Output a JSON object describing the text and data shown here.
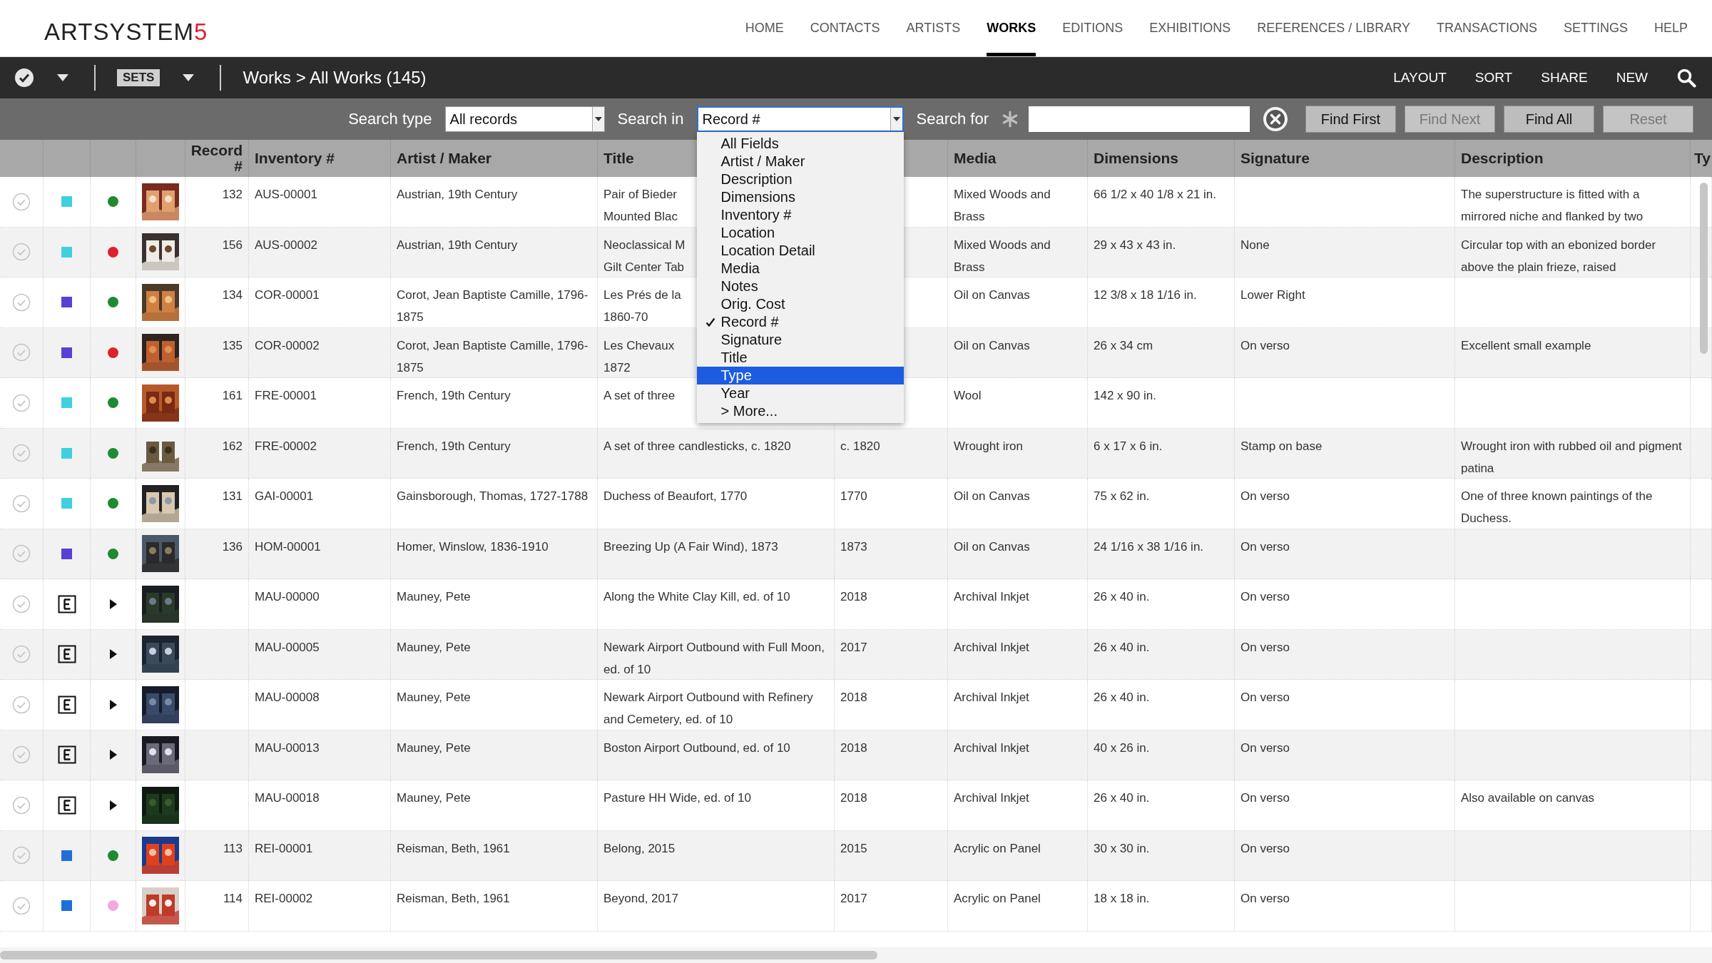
{
  "logo": {
    "text": "ARTSYSTEM",
    "accent": "5"
  },
  "nav": [
    {
      "label": "HOME",
      "selected": false
    },
    {
      "label": "CONTACTS",
      "selected": false
    },
    {
      "label": "ARTISTS",
      "selected": false
    },
    {
      "label": "WORKS",
      "selected": true
    },
    {
      "label": "EDITIONS",
      "selected": false
    },
    {
      "label": "EXHIBITIONS",
      "selected": false
    },
    {
      "label": "REFERENCES / LIBRARY",
      "selected": false
    },
    {
      "label": "TRANSACTIONS",
      "selected": false
    },
    {
      "label": "SETTINGS",
      "selected": false
    },
    {
      "label": "HELP",
      "selected": false
    }
  ],
  "toolbar": {
    "sets": "SETS",
    "breadcrumb": "Works > All Works (145)",
    "actions": [
      "LAYOUT",
      "SORT",
      "SHARE",
      "NEW"
    ]
  },
  "search": {
    "type_label": "Search type",
    "type_value": "All records",
    "in_label": "Search in",
    "in_value": "Record #",
    "for_label": "Search for",
    "menu": [
      {
        "label": "All Fields",
        "checked": false,
        "highlighted": false
      },
      {
        "label": "Artist / Maker",
        "checked": false,
        "highlighted": false
      },
      {
        "label": "Description",
        "checked": false,
        "highlighted": false
      },
      {
        "label": "Dimensions",
        "checked": false,
        "highlighted": false
      },
      {
        "label": "Inventory #",
        "checked": false,
        "highlighted": false
      },
      {
        "label": "Location",
        "checked": false,
        "highlighted": false
      },
      {
        "label": "Location Detail",
        "checked": false,
        "highlighted": false
      },
      {
        "label": "Media",
        "checked": false,
        "highlighted": false
      },
      {
        "label": "Notes",
        "checked": false,
        "highlighted": false
      },
      {
        "label": "Orig. Cost",
        "checked": false,
        "highlighted": false
      },
      {
        "label": "Record #",
        "checked": true,
        "highlighted": false
      },
      {
        "label": "Signature",
        "checked": false,
        "highlighted": false
      },
      {
        "label": "Title",
        "checked": false,
        "highlighted": false
      },
      {
        "label": "Type",
        "checked": false,
        "highlighted": true
      },
      {
        "label": "Year",
        "checked": false,
        "highlighted": false
      },
      {
        "label": "> More...",
        "checked": false,
        "highlighted": false
      }
    ],
    "buttons": [
      {
        "label": "Find First",
        "disabled": false
      },
      {
        "label": "Find Next",
        "disabled": true
      },
      {
        "label": "Find All",
        "disabled": false
      },
      {
        "label": "Reset",
        "disabled": true
      }
    ]
  },
  "table": {
    "columns": [
      "Record #",
      "Inventory #",
      "Artist / Maker",
      "Title",
      null,
      "Media",
      "Dimensions",
      "Signature",
      "Description",
      "Ty"
    ],
    "rows": [
      {
        "kind": "record",
        "selected": false,
        "color": "#3fd0df",
        "status": {
          "color": "#1e8a32"
        },
        "cells": [
          "132",
          "AUS-00001",
          "Austrian, 19th Century",
          "Pair of Bieder\nMounted Blac",
          null,
          "Mixed Woods and Brass",
          "66 1/2 x 40 1/8 x 21 in.",
          null,
          "The superstructure is fitted with a mirrored niche and flanked by two"
        ]
      },
      {
        "kind": "record",
        "selected": false,
        "color": "#3fd0df",
        "status": {
          "color": "#e0202a"
        },
        "cells": [
          "156",
          "AUS-00002",
          "Austrian, 19th Century",
          "Neoclassical M\nGilt Center Tab",
          null,
          "Mixed Woods and Brass",
          "29 x 43 x 43 in.",
          "None",
          "Circular top with an ebonized border above the plain frieze, raised"
        ]
      },
      {
        "kind": "record",
        "selected": false,
        "color": "#5a3fd6",
        "status": {
          "color": "#1e8a32"
        },
        "cells": [
          "134",
          "COR-00001",
          "Corot, Jean Baptiste Camille, 1796-1875",
          "Les Prés de la\n1860-70",
          null,
          "Oil on Canvas",
          "12 3/8 x 18 1/16 in.",
          "Lower Right",
          null
        ]
      },
      {
        "kind": "record",
        "selected": false,
        "color": "#5a3fd6",
        "status": {
          "color": "#e0202a"
        },
        "cells": [
          "135",
          "COR-00002",
          "Corot, Jean Baptiste Camille, 1796-1875",
          "Les Chevaux\n1872",
          null,
          "Oil on Canvas",
          "26 x 34 cm",
          "On verso",
          "Excellent small example"
        ]
      },
      {
        "kind": "record",
        "selected": false,
        "color": "#3fd0df",
        "status": {
          "color": "#1e8a32"
        },
        "cells": [
          "161",
          "FRE-00001",
          "French, 19th Century",
          "A set of three",
          null,
          "Wool",
          "142 x 90 in.",
          null,
          null
        ]
      },
      {
        "kind": "record",
        "selected": false,
        "color": "#3fd0df",
        "status": {
          "color": "#1e8a32"
        },
        "cells": [
          "162",
          "FRE-00002",
          "French, 19th Century",
          "A set of three candlesticks, c. 1820",
          "c. 1820",
          "Wrought iron",
          "6 x 17 x 6 in.",
          "Stamp on base",
          "Wrought iron with rubbed oil and pigment patina"
        ]
      },
      {
        "kind": "record",
        "selected": false,
        "color": "#3fd0df",
        "status": {
          "color": "#1e8a32"
        },
        "cells": [
          "131",
          "GAI-00001",
          "Gainsborough, Thomas, 1727-1788",
          "Duchess of Beaufort, 1770",
          "1770",
          "Oil on Canvas",
          "75 x 62 in.",
          "On verso",
          "One of three known paintings of the Duchess."
        ]
      },
      {
        "kind": "record",
        "selected": false,
        "color": "#5a3fd6",
        "status": {
          "color": "#1e8a32"
        },
        "cells": [
          "136",
          "HOM-00001",
          "Homer, Winslow, 1836-1910",
          "Breezing Up (A Fair Wind), 1873",
          "1873",
          "Oil on Canvas",
          "24 1/16 x 38 1/16 in.",
          "On verso",
          null
        ]
      },
      {
        "kind": "edition",
        "selected": false,
        "expanded": false,
        "cells": [
          null,
          "MAU-00000",
          "Mauney, Pete",
          "Along the White Clay Kill, ed. of 10",
          "2018",
          "Archival Inkjet",
          "26 x 40 in.",
          "On verso",
          null
        ]
      },
      {
        "kind": "edition",
        "selected": false,
        "expanded": false,
        "cells": [
          null,
          "MAU-00005",
          "Mauney, Pete",
          "Newark Airport Outbound with Full Moon, ed. of 10",
          "2017",
          "Archival Inkjet",
          "26 x 40 in.",
          "On verso",
          null
        ]
      },
      {
        "kind": "edition",
        "selected": false,
        "expanded": false,
        "cells": [
          null,
          "MAU-00008",
          "Mauney, Pete",
          "Newark Airport Outbound with Refinery and Cemetery, ed. of 10",
          "2018",
          "Archival Inkjet",
          "26 x 40 in.",
          "On verso",
          null
        ]
      },
      {
        "kind": "edition",
        "selected": false,
        "expanded": false,
        "cells": [
          null,
          "MAU-00013",
          "Mauney, Pete",
          "Boston Airport Outbound, ed. of 10",
          "2018",
          "Archival Inkjet",
          "40 x 26 in.",
          "On verso",
          null
        ]
      },
      {
        "kind": "edition",
        "selected": false,
        "expanded": false,
        "cells": [
          null,
          "MAU-00018",
          "Mauney, Pete",
          "Pasture HH Wide, ed. of 10",
          "2018",
          "Archival Inkjet",
          "26 x 40 in.",
          "On verso",
          "Also available on canvas"
        ]
      },
      {
        "kind": "record",
        "selected": false,
        "color": "#1f6fd8",
        "status": {
          "color": "#1e8a32"
        },
        "cells": [
          "113",
          "REI-00001",
          "Reisman, Beth, 1961",
          "Belong, 2015",
          "2015",
          "Acrylic on Panel",
          "30 x 30 in.",
          "On verso",
          null
        ]
      },
      {
        "kind": "record",
        "selected": false,
        "color": "#1f6fd8",
        "status": {
          "color": "#f4a8dc"
        },
        "cells": [
          "114",
          "REI-00002",
          "Reisman, Beth, 1961",
          "Beyond, 2017",
          "2017",
          "Acrylic on Panel",
          "18 x 18 in.",
          "On verso",
          null
        ]
      }
    ]
  }
}
